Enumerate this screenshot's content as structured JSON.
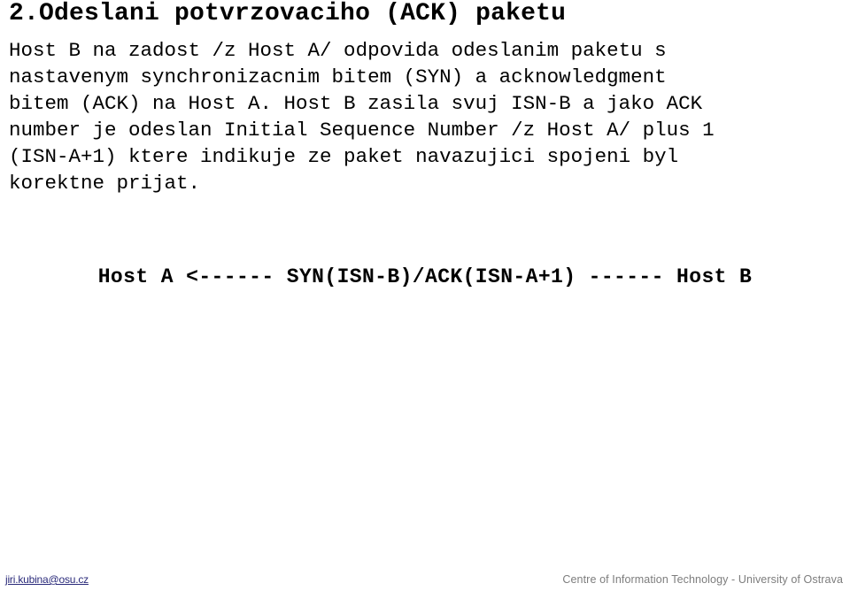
{
  "slide": {
    "title": "2.Odeslani potvrzovaciho (ACK) paketu",
    "body_lines": [
      "Host B na zadost /z Host A/ odpovida odeslanim paketu s",
      "nastavenym synchronizacnim bitem (SYN) a acknowledgment",
      "bitem (ACK) na Host A. Host B zasila svuj ISN-B a jako ACK",
      "number je odeslan Initial Sequence Number /z Host A/ plus 1",
      "(ISN-A+1) ktere indikuje ze paket navazujici spojeni byl",
      "korektne prijat."
    ],
    "diagram": {
      "line": "Host A <------ SYN(ISN-B)/ACK(ISN-A+1) ------ Host B"
    }
  },
  "footer": {
    "email": "jiri.kubina@osu.cz",
    "organization": "Centre of Information Technology - University of Ostrava"
  },
  "colors": {
    "background": "#ffffff",
    "text": "#000000",
    "link": "#2a2a7a",
    "footer_text": "#7d7d7d"
  }
}
